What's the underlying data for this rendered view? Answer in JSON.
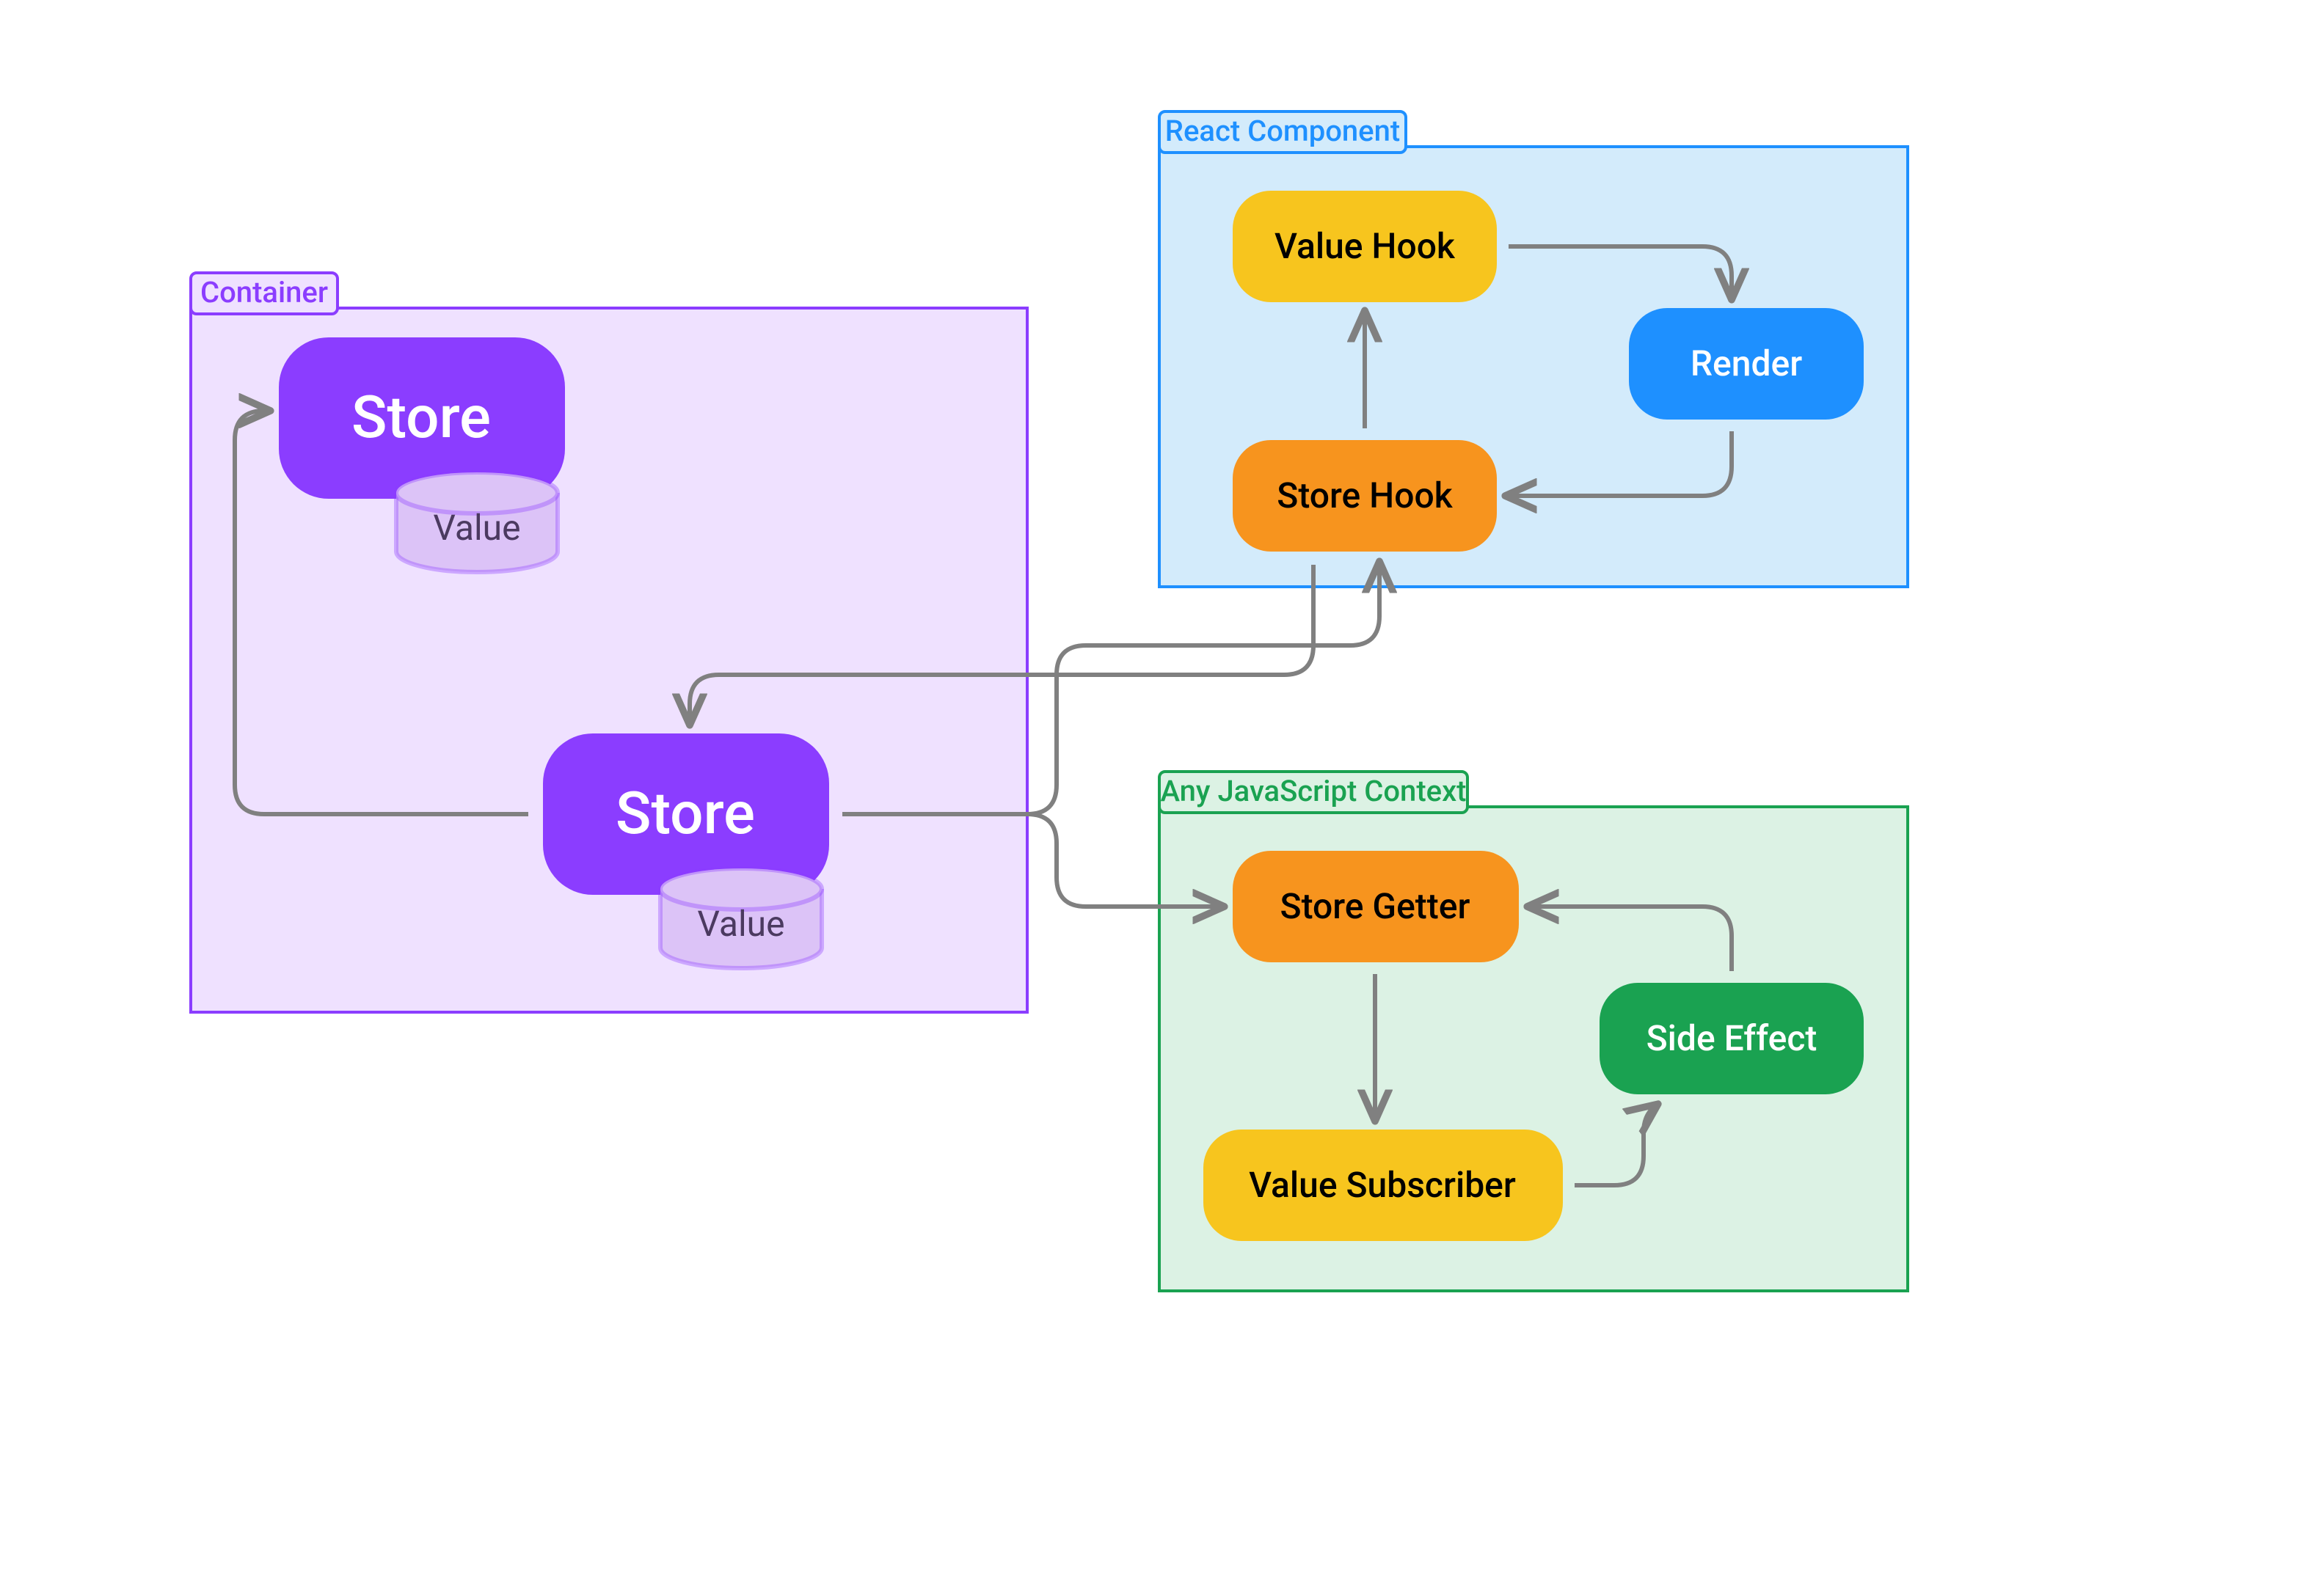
{
  "groups": {
    "container": {
      "label": "Container"
    },
    "react": {
      "label": "React Component"
    },
    "js": {
      "label": "Any JavaScript Context"
    }
  },
  "nodes": {
    "store1": {
      "label": "Store"
    },
    "store2": {
      "label": "Store"
    },
    "value1": {
      "label": "Value"
    },
    "value2": {
      "label": "Value"
    },
    "valueHook": {
      "label": "Value Hook"
    },
    "storeHook": {
      "label": "Store Hook"
    },
    "render": {
      "label": "Render"
    },
    "storeGetter": {
      "label": "Store Getter"
    },
    "valueSubscriber": {
      "label": "Value Subscriber"
    },
    "sideEffect": {
      "label": "Side Effect"
    }
  },
  "colors": {
    "purple": "#8b3dff",
    "purpleFill": "#efe1ff",
    "purpleLight": "#dcc3f7",
    "blue": "#1e90ff",
    "blueFill": "#d3ebfb",
    "blueNode": "#1e90ff",
    "green": "#1aa251",
    "greenFill": "#dcf2e4",
    "greenNode": "#1aa251",
    "orange": "#f7941e",
    "yellow": "#f7c51e",
    "arrow": "#808080"
  }
}
